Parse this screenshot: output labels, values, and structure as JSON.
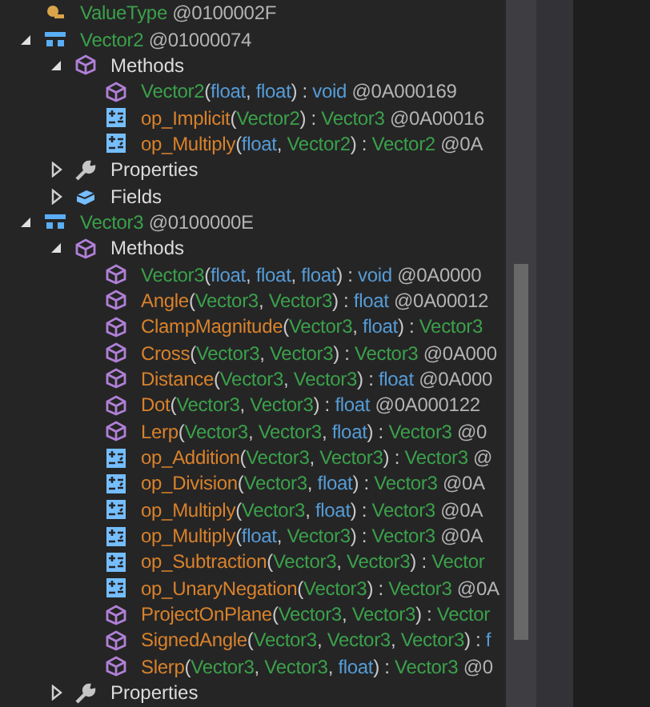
{
  "tree": [
    {
      "kind": "base",
      "label": "ValueType",
      "token": "@0100002F"
    },
    {
      "kind": "class",
      "label": "Vector2",
      "token": "@01000074",
      "expanded": true,
      "children": [
        {
          "kind": "methods",
          "label": "Methods",
          "expanded": true,
          "members": [
            {
              "kind": "constructor",
              "parts": [
                {
                  "text": "Vector2",
                  "kind": "type"
                },
                {
                  "text": "(",
                  "kind": "punct"
                },
                {
                  "text": "float",
                  "kind": "keyword"
                },
                {
                  "text": ", ",
                  "kind": "punct"
                },
                {
                  "text": "float",
                  "kind": "keyword"
                },
                {
                  "text": ") : ",
                  "kind": "punct"
                },
                {
                  "text": "void",
                  "kind": "keyword"
                },
                {
                  "text": " @0A000169",
                  "kind": "token"
                }
              ]
            },
            {
              "kind": "operator",
              "parts": [
                {
                  "text": "op_Implicit",
                  "kind": "name"
                },
                {
                  "text": "(",
                  "kind": "punct"
                },
                {
                  "text": "Vector2",
                  "kind": "type"
                },
                {
                  "text": ") : ",
                  "kind": "punct"
                },
                {
                  "text": "Vector3",
                  "kind": "type"
                },
                {
                  "text": " @0A00016",
                  "kind": "token"
                }
              ]
            },
            {
              "kind": "operator",
              "parts": [
                {
                  "text": "op_Multiply",
                  "kind": "name"
                },
                {
                  "text": "(",
                  "kind": "punct"
                },
                {
                  "text": "float",
                  "kind": "keyword"
                },
                {
                  "text": ", ",
                  "kind": "punct"
                },
                {
                  "text": "Vector2",
                  "kind": "type"
                },
                {
                  "text": ") : ",
                  "kind": "punct"
                },
                {
                  "text": "Vector2",
                  "kind": "type"
                },
                {
                  "text": " @0A",
                  "kind": "token"
                }
              ]
            }
          ]
        },
        {
          "kind": "properties",
          "label": "Properties",
          "expanded": false
        },
        {
          "kind": "fields",
          "label": "Fields",
          "expanded": false
        }
      ]
    },
    {
      "kind": "class",
      "label": "Vector3",
      "token": "@0100000E",
      "expanded": true,
      "children": [
        {
          "kind": "methods",
          "label": "Methods",
          "expanded": true,
          "members": [
            {
              "kind": "constructor",
              "parts": [
                {
                  "text": "Vector3",
                  "kind": "type"
                },
                {
                  "text": "(",
                  "kind": "punct"
                },
                {
                  "text": "float",
                  "kind": "keyword"
                },
                {
                  "text": ", ",
                  "kind": "punct"
                },
                {
                  "text": "float",
                  "kind": "keyword"
                },
                {
                  "text": ", ",
                  "kind": "punct"
                },
                {
                  "text": "float",
                  "kind": "keyword"
                },
                {
                  "text": ") : ",
                  "kind": "punct"
                },
                {
                  "text": "void",
                  "kind": "keyword"
                },
                {
                  "text": " @0A0000",
                  "kind": "token"
                }
              ]
            },
            {
              "kind": "method",
              "parts": [
                {
                  "text": "Angle",
                  "kind": "name"
                },
                {
                  "text": "(",
                  "kind": "punct"
                },
                {
                  "text": "Vector3",
                  "kind": "type"
                },
                {
                  "text": ", ",
                  "kind": "punct"
                },
                {
                  "text": "Vector3",
                  "kind": "type"
                },
                {
                  "text": ") : ",
                  "kind": "punct"
                },
                {
                  "text": "float",
                  "kind": "keyword"
                },
                {
                  "text": " @0A00012",
                  "kind": "token"
                }
              ]
            },
            {
              "kind": "method",
              "parts": [
                {
                  "text": "ClampMagnitude",
                  "kind": "name"
                },
                {
                  "text": "(",
                  "kind": "punct"
                },
                {
                  "text": "Vector3",
                  "kind": "type"
                },
                {
                  "text": ", ",
                  "kind": "punct"
                },
                {
                  "text": "float",
                  "kind": "keyword"
                },
                {
                  "text": ") : ",
                  "kind": "punct"
                },
                {
                  "text": "Vector3",
                  "kind": "type"
                }
              ]
            },
            {
              "kind": "method",
              "parts": [
                {
                  "text": "Cross",
                  "kind": "name"
                },
                {
                  "text": "(",
                  "kind": "punct"
                },
                {
                  "text": "Vector3",
                  "kind": "type"
                },
                {
                  "text": ", ",
                  "kind": "punct"
                },
                {
                  "text": "Vector3",
                  "kind": "type"
                },
                {
                  "text": ") : ",
                  "kind": "punct"
                },
                {
                  "text": "Vector3",
                  "kind": "type"
                },
                {
                  "text": " @0A000",
                  "kind": "token"
                }
              ]
            },
            {
              "kind": "method",
              "parts": [
                {
                  "text": "Distance",
                  "kind": "name"
                },
                {
                  "text": "(",
                  "kind": "punct"
                },
                {
                  "text": "Vector3",
                  "kind": "type"
                },
                {
                  "text": ", ",
                  "kind": "punct"
                },
                {
                  "text": "Vector3",
                  "kind": "type"
                },
                {
                  "text": ") : ",
                  "kind": "punct"
                },
                {
                  "text": "float",
                  "kind": "keyword"
                },
                {
                  "text": " @0A000",
                  "kind": "token"
                }
              ]
            },
            {
              "kind": "method",
              "parts": [
                {
                  "text": "Dot",
                  "kind": "name"
                },
                {
                  "text": "(",
                  "kind": "punct"
                },
                {
                  "text": "Vector3",
                  "kind": "type"
                },
                {
                  "text": ", ",
                  "kind": "punct"
                },
                {
                  "text": "Vector3",
                  "kind": "type"
                },
                {
                  "text": ") : ",
                  "kind": "punct"
                },
                {
                  "text": "float",
                  "kind": "keyword"
                },
                {
                  "text": " @0A000122",
                  "kind": "token"
                }
              ]
            },
            {
              "kind": "method",
              "parts": [
                {
                  "text": "Lerp",
                  "kind": "name"
                },
                {
                  "text": "(",
                  "kind": "punct"
                },
                {
                  "text": "Vector3",
                  "kind": "type"
                },
                {
                  "text": ", ",
                  "kind": "punct"
                },
                {
                  "text": "Vector3",
                  "kind": "type"
                },
                {
                  "text": ", ",
                  "kind": "punct"
                },
                {
                  "text": "float",
                  "kind": "keyword"
                },
                {
                  "text": ") : ",
                  "kind": "punct"
                },
                {
                  "text": "Vector3",
                  "kind": "type"
                },
                {
                  "text": " @0",
                  "kind": "token"
                }
              ]
            },
            {
              "kind": "operator",
              "parts": [
                {
                  "text": "op_Addition",
                  "kind": "name"
                },
                {
                  "text": "(",
                  "kind": "punct"
                },
                {
                  "text": "Vector3",
                  "kind": "type"
                },
                {
                  "text": ", ",
                  "kind": "punct"
                },
                {
                  "text": "Vector3",
                  "kind": "type"
                },
                {
                  "text": ") : ",
                  "kind": "punct"
                },
                {
                  "text": "Vector3",
                  "kind": "type"
                },
                {
                  "text": " @",
                  "kind": "token"
                }
              ]
            },
            {
              "kind": "operator",
              "parts": [
                {
                  "text": "op_Division",
                  "kind": "name"
                },
                {
                  "text": "(",
                  "kind": "punct"
                },
                {
                  "text": "Vector3",
                  "kind": "type"
                },
                {
                  "text": ", ",
                  "kind": "punct"
                },
                {
                  "text": "float",
                  "kind": "keyword"
                },
                {
                  "text": ") : ",
                  "kind": "punct"
                },
                {
                  "text": "Vector3",
                  "kind": "type"
                },
                {
                  "text": " @0A",
                  "kind": "token"
                }
              ]
            },
            {
              "kind": "operator",
              "parts": [
                {
                  "text": "op_Multiply",
                  "kind": "name"
                },
                {
                  "text": "(",
                  "kind": "punct"
                },
                {
                  "text": "Vector3",
                  "kind": "type"
                },
                {
                  "text": ", ",
                  "kind": "punct"
                },
                {
                  "text": "float",
                  "kind": "keyword"
                },
                {
                  "text": ") : ",
                  "kind": "punct"
                },
                {
                  "text": "Vector3",
                  "kind": "type"
                },
                {
                  "text": " @0A",
                  "kind": "token"
                }
              ]
            },
            {
              "kind": "operator",
              "parts": [
                {
                  "text": "op_Multiply",
                  "kind": "name"
                },
                {
                  "text": "(",
                  "kind": "punct"
                },
                {
                  "text": "float",
                  "kind": "keyword"
                },
                {
                  "text": ", ",
                  "kind": "punct"
                },
                {
                  "text": "Vector3",
                  "kind": "type"
                },
                {
                  "text": ") : ",
                  "kind": "punct"
                },
                {
                  "text": "Vector3",
                  "kind": "type"
                },
                {
                  "text": " @0A",
                  "kind": "token"
                }
              ]
            },
            {
              "kind": "operator",
              "parts": [
                {
                  "text": "op_Subtraction",
                  "kind": "name"
                },
                {
                  "text": "(",
                  "kind": "punct"
                },
                {
                  "text": "Vector3",
                  "kind": "type"
                },
                {
                  "text": ", ",
                  "kind": "punct"
                },
                {
                  "text": "Vector3",
                  "kind": "type"
                },
                {
                  "text": ") : ",
                  "kind": "punct"
                },
                {
                  "text": "Vector",
                  "kind": "type"
                }
              ]
            },
            {
              "kind": "operator",
              "parts": [
                {
                  "text": "op_UnaryNegation",
                  "kind": "name"
                },
                {
                  "text": "(",
                  "kind": "punct"
                },
                {
                  "text": "Vector3",
                  "kind": "type"
                },
                {
                  "text": ") : ",
                  "kind": "punct"
                },
                {
                  "text": "Vector3",
                  "kind": "type"
                },
                {
                  "text": " @0A",
                  "kind": "token"
                }
              ]
            },
            {
              "kind": "method",
              "parts": [
                {
                  "text": "ProjectOnPlane",
                  "kind": "name"
                },
                {
                  "text": "(",
                  "kind": "punct"
                },
                {
                  "text": "Vector3",
                  "kind": "type"
                },
                {
                  "text": ", ",
                  "kind": "punct"
                },
                {
                  "text": "Vector3",
                  "kind": "type"
                },
                {
                  "text": ") : ",
                  "kind": "punct"
                },
                {
                  "text": "Vector",
                  "kind": "type"
                }
              ]
            },
            {
              "kind": "method",
              "parts": [
                {
                  "text": "SignedAngle",
                  "kind": "name"
                },
                {
                  "text": "(",
                  "kind": "punct"
                },
                {
                  "text": "Vector3",
                  "kind": "type"
                },
                {
                  "text": ", ",
                  "kind": "punct"
                },
                {
                  "text": "Vector3",
                  "kind": "type"
                },
                {
                  "text": ", ",
                  "kind": "punct"
                },
                {
                  "text": "Vector3",
                  "kind": "type"
                },
                {
                  "text": ") : ",
                  "kind": "punct"
                },
                {
                  "text": "f",
                  "kind": "keyword"
                }
              ]
            },
            {
              "kind": "method",
              "parts": [
                {
                  "text": "Slerp",
                  "kind": "name"
                },
                {
                  "text": "(",
                  "kind": "punct"
                },
                {
                  "text": "Vector3",
                  "kind": "type"
                },
                {
                  "text": ", ",
                  "kind": "punct"
                },
                {
                  "text": "Vector3",
                  "kind": "type"
                },
                {
                  "text": ", ",
                  "kind": "punct"
                },
                {
                  "text": "float",
                  "kind": "keyword"
                },
                {
                  "text": ") : ",
                  "kind": "punct"
                },
                {
                  "text": "Vector3",
                  "kind": "type"
                },
                {
                  "text": " @0",
                  "kind": "token"
                }
              ]
            }
          ]
        },
        {
          "kind": "properties",
          "label": "Properties",
          "expanded": false
        }
      ]
    }
  ]
}
